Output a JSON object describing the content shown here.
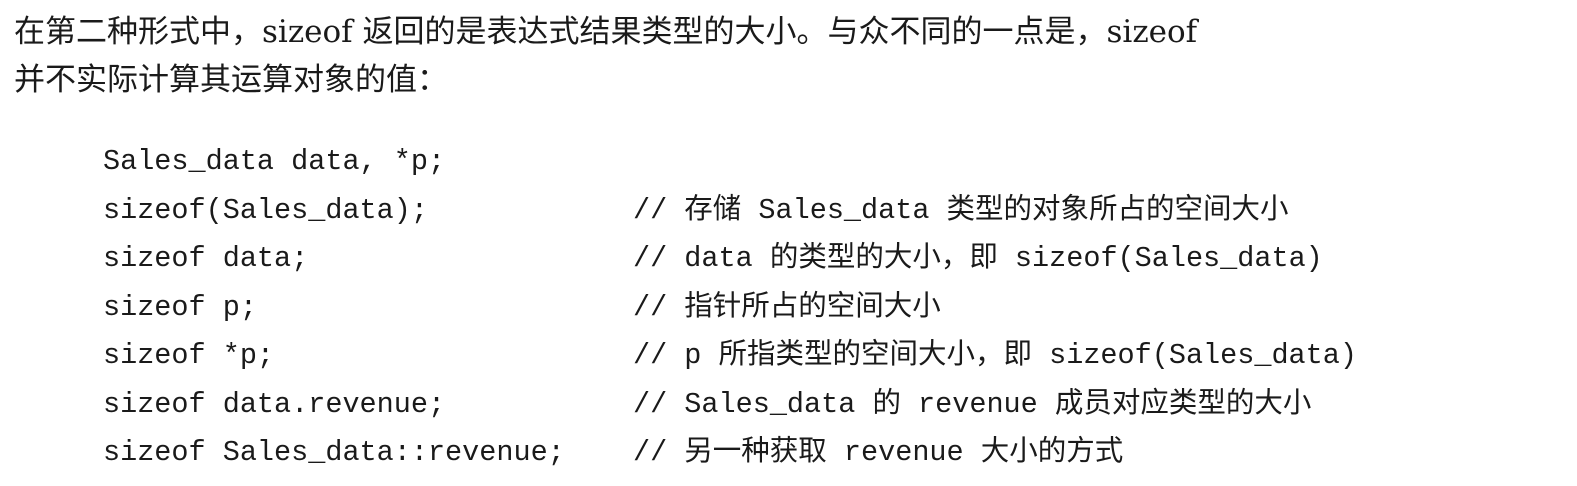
{
  "paragraph": {
    "line1": "在第二种形式中，sizeof 返回的是表达式结果类型的大小。与众不同的一点是，sizeof",
    "line2": "并不实际计算其运算对象的值："
  },
  "code": {
    "lines": [
      {
        "stmt": "Sales_data data, *p;",
        "comment": ""
      },
      {
        "stmt": "sizeof(Sales_data);",
        "comment": "// 存储 Sales_data 类型的对象所占的空间大小"
      },
      {
        "stmt": "sizeof data;",
        "comment": "// data 的类型的大小，即 sizeof(Sales_data)"
      },
      {
        "stmt": "sizeof p;",
        "comment": "// 指针所占的空间大小"
      },
      {
        "stmt": "sizeof *p;",
        "comment": "// p 所指类型的空间大小，即 sizeof(Sales_data)"
      },
      {
        "stmt": "sizeof data.revenue;",
        "comment": "// Sales_data 的 revenue 成员对应类型的大小"
      },
      {
        "stmt": "sizeof Sales_data::revenue;",
        "comment": "// 另一种获取 revenue 大小的方式"
      }
    ]
  }
}
